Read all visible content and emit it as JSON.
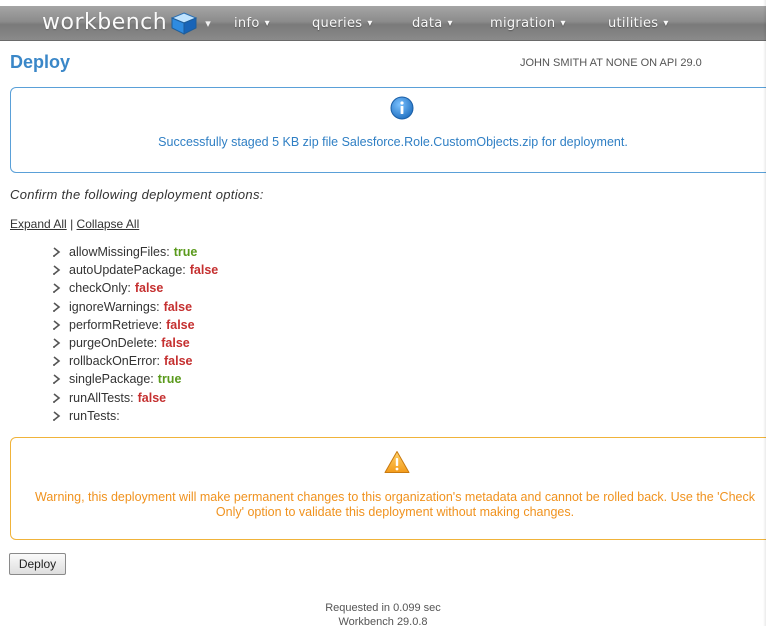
{
  "nav": {
    "logo_text": "workbench",
    "menus": [
      {
        "label": "info"
      },
      {
        "label": "queries"
      },
      {
        "label": "data"
      },
      {
        "label": "migration"
      },
      {
        "label": "utilities"
      }
    ]
  },
  "page": {
    "title": "Deploy",
    "user_info": "JOHN SMITH AT NONE ON API 29.0"
  },
  "info_box": {
    "icon": "info-icon",
    "message": "Successfully staged 5 KB zip file Salesforce.Role.CustomObjects.zip for deployment."
  },
  "confirm_text": "Confirm the following deployment options:",
  "expand_all": "Expand All",
  "separator": "|",
  "collapse_all": "Collapse All",
  "options": [
    {
      "name": "allowMissingFiles:",
      "value": "true"
    },
    {
      "name": "autoUpdatePackage:",
      "value": "false"
    },
    {
      "name": "checkOnly:",
      "value": "false"
    },
    {
      "name": "ignoreWarnings:",
      "value": "false"
    },
    {
      "name": "performRetrieve:",
      "value": "false"
    },
    {
      "name": "purgeOnDelete:",
      "value": "false"
    },
    {
      "name": "rollbackOnError:",
      "value": "false"
    },
    {
      "name": "singlePackage:",
      "value": "true"
    },
    {
      "name": "runAllTests:",
      "value": "false"
    },
    {
      "name": "runTests:",
      "value": ""
    }
  ],
  "warning": {
    "icon": "warning-icon",
    "message": "Warning, this deployment will make permanent changes to this organization's metadata and cannot be rolled back. Use the 'Check Only' option to validate this deployment without making changes."
  },
  "deploy_button": "Deploy",
  "footer": {
    "requested": "Requested in 0.099 sec",
    "version": "Workbench 29.0.8"
  },
  "colors": {
    "accent": "#3a87c8",
    "true": "#5a9a1c",
    "false": "#c53030",
    "warning": "#f0921e"
  }
}
